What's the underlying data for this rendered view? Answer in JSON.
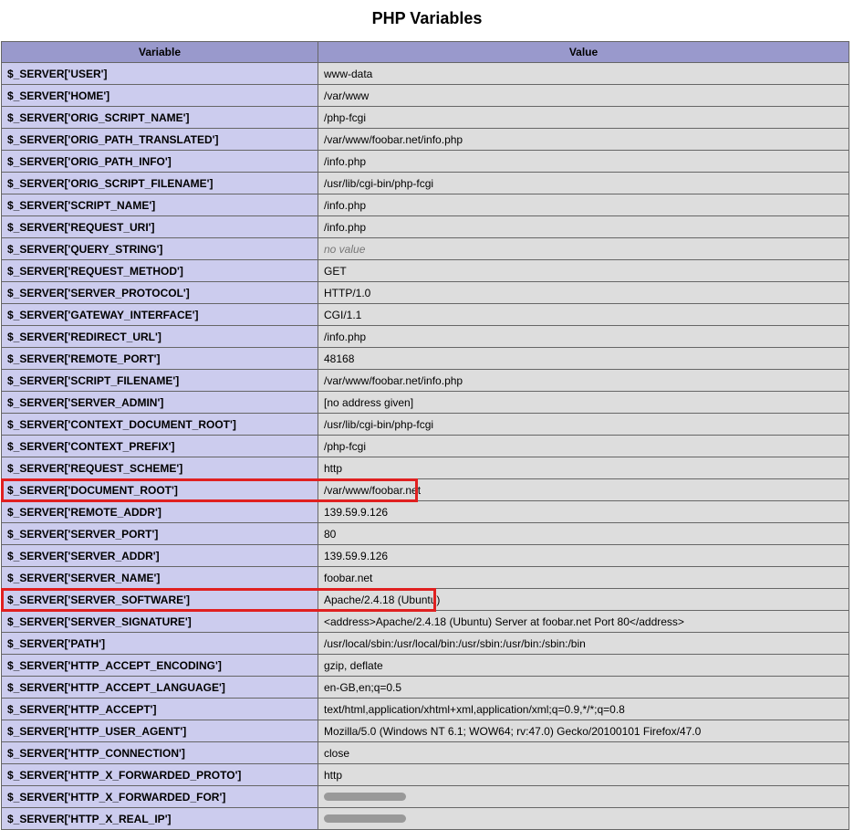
{
  "title": "PHP Variables",
  "headers": {
    "variable": "Variable",
    "value": "Value"
  },
  "no_value_label": "no value",
  "rows": [
    {
      "key": "$_SERVER['USER']",
      "value": "www-data"
    },
    {
      "key": "$_SERVER['HOME']",
      "value": "/var/www"
    },
    {
      "key": "$_SERVER['ORIG_SCRIPT_NAME']",
      "value": "/php-fcgi"
    },
    {
      "key": "$_SERVER['ORIG_PATH_TRANSLATED']",
      "value": "/var/www/foobar.net/info.php"
    },
    {
      "key": "$_SERVER['ORIG_PATH_INFO']",
      "value": "/info.php"
    },
    {
      "key": "$_SERVER['ORIG_SCRIPT_FILENAME']",
      "value": "/usr/lib/cgi-bin/php-fcgi"
    },
    {
      "key": "$_SERVER['SCRIPT_NAME']",
      "value": "/info.php"
    },
    {
      "key": "$_SERVER['REQUEST_URI']",
      "value": "/info.php"
    },
    {
      "key": "$_SERVER['QUERY_STRING']",
      "value": "",
      "no_value": true
    },
    {
      "key": "$_SERVER['REQUEST_METHOD']",
      "value": "GET"
    },
    {
      "key": "$_SERVER['SERVER_PROTOCOL']",
      "value": "HTTP/1.0"
    },
    {
      "key": "$_SERVER['GATEWAY_INTERFACE']",
      "value": "CGI/1.1"
    },
    {
      "key": "$_SERVER['REDIRECT_URL']",
      "value": "/info.php"
    },
    {
      "key": "$_SERVER['REMOTE_PORT']",
      "value": "48168"
    },
    {
      "key": "$_SERVER['SCRIPT_FILENAME']",
      "value": "/var/www/foobar.net/info.php"
    },
    {
      "key": "$_SERVER['SERVER_ADMIN']",
      "value": "[no address given]"
    },
    {
      "key": "$_SERVER['CONTEXT_DOCUMENT_ROOT']",
      "value": "/usr/lib/cgi-bin/php-fcgi"
    },
    {
      "key": "$_SERVER['CONTEXT_PREFIX']",
      "value": "/php-fcgi"
    },
    {
      "key": "$_SERVER['REQUEST_SCHEME']",
      "value": "http"
    },
    {
      "key": "$_SERVER['DOCUMENT_ROOT']",
      "value": "/var/www/foobar.net",
      "highlight": true,
      "hl_width": 455
    },
    {
      "key": "$_SERVER['REMOTE_ADDR']",
      "value": "139.59.9.126"
    },
    {
      "key": "$_SERVER['SERVER_PORT']",
      "value": "80"
    },
    {
      "key": "$_SERVER['SERVER_ADDR']",
      "value": "139.59.9.126"
    },
    {
      "key": "$_SERVER['SERVER_NAME']",
      "value": "foobar.net"
    },
    {
      "key": "$_SERVER['SERVER_SOFTWARE']",
      "value": "Apache/2.4.18 (Ubuntu)",
      "highlight": true,
      "hl_width": 475
    },
    {
      "key": "$_SERVER['SERVER_SIGNATURE']",
      "value": "<address>Apache/2.4.18 (Ubuntu) Server at foobar.net Port 80</address>"
    },
    {
      "key": "$_SERVER['PATH']",
      "value": "/usr/local/sbin:/usr/local/bin:/usr/sbin:/usr/bin:/sbin:/bin"
    },
    {
      "key": "$_SERVER['HTTP_ACCEPT_ENCODING']",
      "value": "gzip, deflate"
    },
    {
      "key": "$_SERVER['HTTP_ACCEPT_LANGUAGE']",
      "value": "en-GB,en;q=0.5"
    },
    {
      "key": "$_SERVER['HTTP_ACCEPT']",
      "value": "text/html,application/xhtml+xml,application/xml;q=0.9,*/*;q=0.8"
    },
    {
      "key": "$_SERVER['HTTP_USER_AGENT']",
      "value": "Mozilla/5.0 (Windows NT 6.1; WOW64; rv:47.0) Gecko/20100101 Firefox/47.0"
    },
    {
      "key": "$_SERVER['HTTP_CONNECTION']",
      "value": "close"
    },
    {
      "key": "$_SERVER['HTTP_X_FORWARDED_PROTO']",
      "value": "http"
    },
    {
      "key": "$_SERVER['HTTP_X_FORWARDED_FOR']",
      "value": "",
      "redacted": true
    },
    {
      "key": "$_SERVER['HTTP_X_REAL_IP']",
      "value": "",
      "redacted": true
    }
  ]
}
